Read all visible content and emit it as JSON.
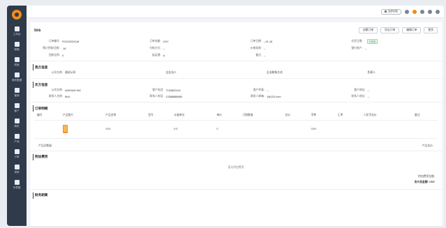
{
  "sidebar": {
    "items": [
      {
        "label": "工作台",
        "icon": "home-icon"
      },
      {
        "label": "邮箱",
        "icon": "mail-icon"
      },
      {
        "label": "线索",
        "icon": "leads-icon"
      },
      {
        "label": "海关数据",
        "icon": "customs-icon"
      },
      {
        "label": "营销",
        "icon": "marketing-icon"
      },
      {
        "label": "客户",
        "icon": "customer-icon"
      },
      {
        "label": "商机",
        "icon": "opportunity-icon"
      },
      {
        "label": "产品",
        "icon": "product-icon"
      },
      {
        "label": "订单",
        "icon": "order-icon"
      },
      {
        "label": "采购",
        "icon": "purchase-icon"
      },
      {
        "label": "仪表盘",
        "icon": "dashboard-icon"
      }
    ]
  },
  "topbar": {
    "pill": "全部功能"
  },
  "page": {
    "title": "ios",
    "buttons": [
      "创建订单",
      "导出订单",
      "编辑订单",
      "更多"
    ]
  },
  "order_info": [
    {
      "k": "订单编号:",
      "v": "FKD20220118"
    },
    {
      "k": "订单金额:",
      "v": "CNY"
    },
    {
      "k": "订单日期:",
      "v": "--01-18"
    },
    {
      "k": "交货日期:",
      "v": ""
    },
    {
      "k": "预计到账/回款:",
      "v": "-18"
    },
    {
      "k": "付款方式:",
      "v": "--"
    },
    {
      "k": "价格条款:",
      "v": "--"
    },
    {
      "k": "银行账户:",
      "v": "--"
    },
    {
      "k": "回款比例:",
      "v": "0"
    },
    {
      "k": "起运港:",
      "v": "A"
    },
    {
      "k": "备注:",
      "v": "--"
    },
    {
      "k": "",
      "v": ""
    }
  ],
  "badge": "已完成",
  "seller": {
    "title": "我方信息",
    "fields": [
      {
        "k": "公司名称:",
        "v": "测试公司"
      },
      {
        "k": "",
        "v": "企业法人"
      },
      {
        "k": "",
        "v": "企业联系方式"
      },
      {
        "k": "",
        "v": "负责人"
      }
    ]
  },
  "buyer": {
    "title": "买方信息",
    "fields": [
      {
        "k": "公司名称:",
        "v": "AIDISAM INC"
      },
      {
        "k": "客户电话:",
        "v": "7154822415"
      },
      {
        "k": "客户传真:",
        "v": "--"
      },
      {
        "k": "客户地址:",
        "v": "--"
      },
      {
        "k": "联系人名称:",
        "v": "M•A"
      },
      {
        "k": "联系人电话:",
        "v": "13388888888"
      },
      {
        "k": "联系人邮箱:",
        "v": "1@123.com"
      },
      {
        "k": "联系人地址:",
        "v": "--"
      }
    ]
  },
  "details": {
    "title": "订单明细",
    "columns": [
      "编号",
      "产品图片",
      "产品名称",
      "型号",
      "计量单位",
      "单价",
      "订购数量",
      "总价",
      "币种",
      "汇率",
      "人民币总价",
      "备注"
    ],
    "row": [
      "",
      "",
      "XXX",
      "",
      "KG",
      "0",
      "",
      "",
      "CNY",
      "",
      "",
      ""
    ],
    "total_left": "产品总数量:",
    "total_right": "产品总价:"
  },
  "fees": {
    "title": "附加费用",
    "empty": "暂无附加费用",
    "line1": "附加费用金额:",
    "line2": "合计总金额: CNY"
  },
  "finance": {
    "title": "财务剥离"
  }
}
